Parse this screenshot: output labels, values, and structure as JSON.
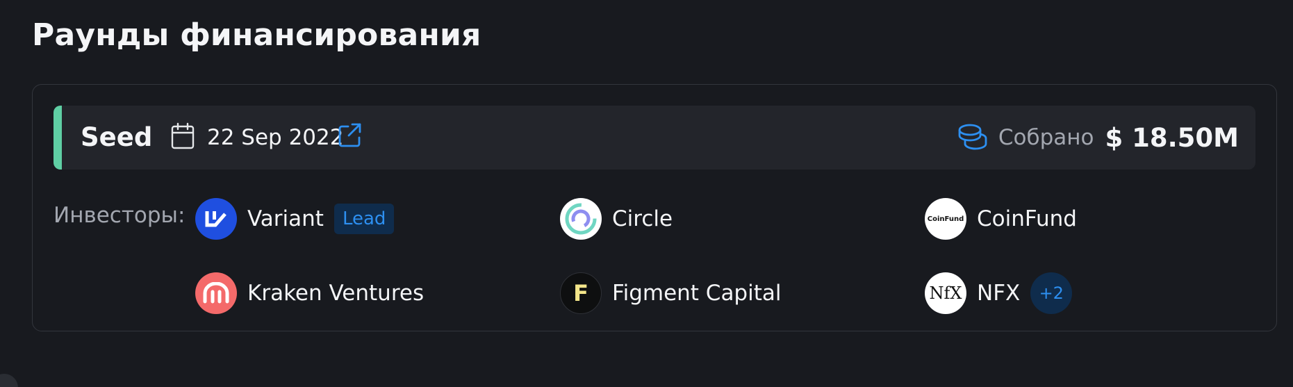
{
  "section": {
    "title": "Раунды финансирования"
  },
  "round": {
    "stage": "Seed",
    "date": "22 Sep 2022",
    "raised_label": "Собрано",
    "raised_amount": "$ 18.50M",
    "accent_color": "#5fcfa4"
  },
  "investors": {
    "label": "Инвесторы:",
    "items": [
      {
        "name": "Variant",
        "logo": "variant-logo",
        "badge": "Lead"
      },
      {
        "name": "Circle",
        "logo": "circle-logo"
      },
      {
        "name": "CoinFund",
        "logo": "coinfund-logo",
        "logo_text": "CoinFund"
      },
      {
        "name": "Kraken Ventures",
        "logo": "kraken-logo"
      },
      {
        "name": "Figment Capital",
        "logo": "figment-logo",
        "logo_text": "F"
      },
      {
        "name": "NFX",
        "logo": "nfx-logo",
        "logo_text": "NfX",
        "more": "+2"
      }
    ]
  },
  "colors": {
    "background": "#181a1f",
    "accent_blue": "#2d8ff0",
    "badge_bg": "#0f2c4c"
  }
}
